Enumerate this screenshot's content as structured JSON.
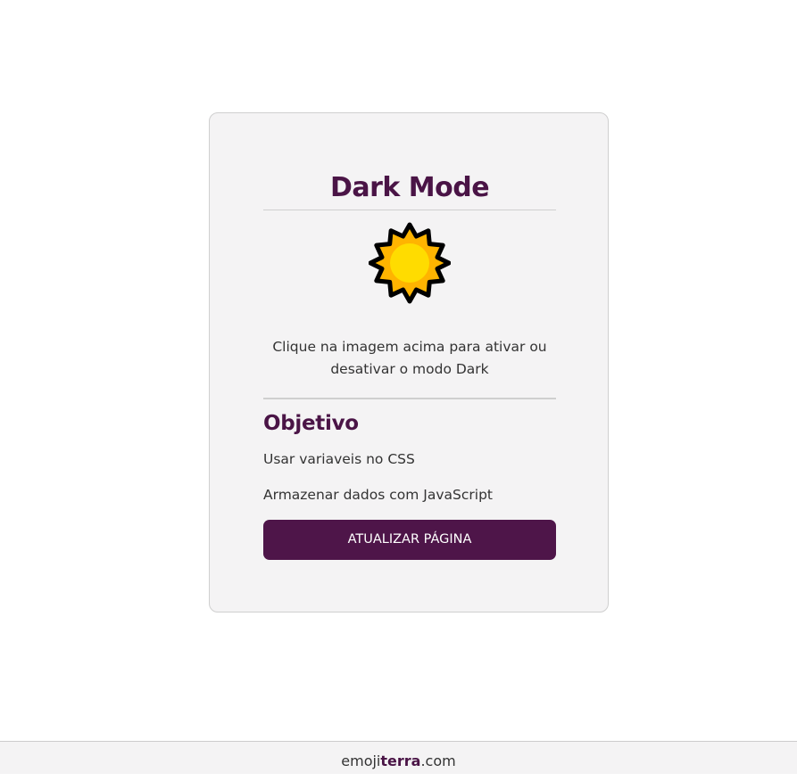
{
  "card": {
    "title": "Dark Mode",
    "toggle_icon": "sun-icon",
    "instruction": "Clique na imagem acima para ativar ou desativar o modo Dark",
    "section_heading": "Objetivo",
    "goals": [
      "Usar variaveis no CSS",
      "Armazenar dados com JavaScript"
    ],
    "refresh_button_label": "ATUALIZAR PÁGINA"
  },
  "footer": {
    "brand_prefix": "emoji",
    "brand_bold": "terra",
    "brand_suffix": ".com"
  },
  "colors": {
    "accent": "#4e1549",
    "title": "#4a1446",
    "card_bg": "#f4f3f4",
    "sun_inner": "#ffdc00",
    "sun_rays": "#ffb400"
  }
}
